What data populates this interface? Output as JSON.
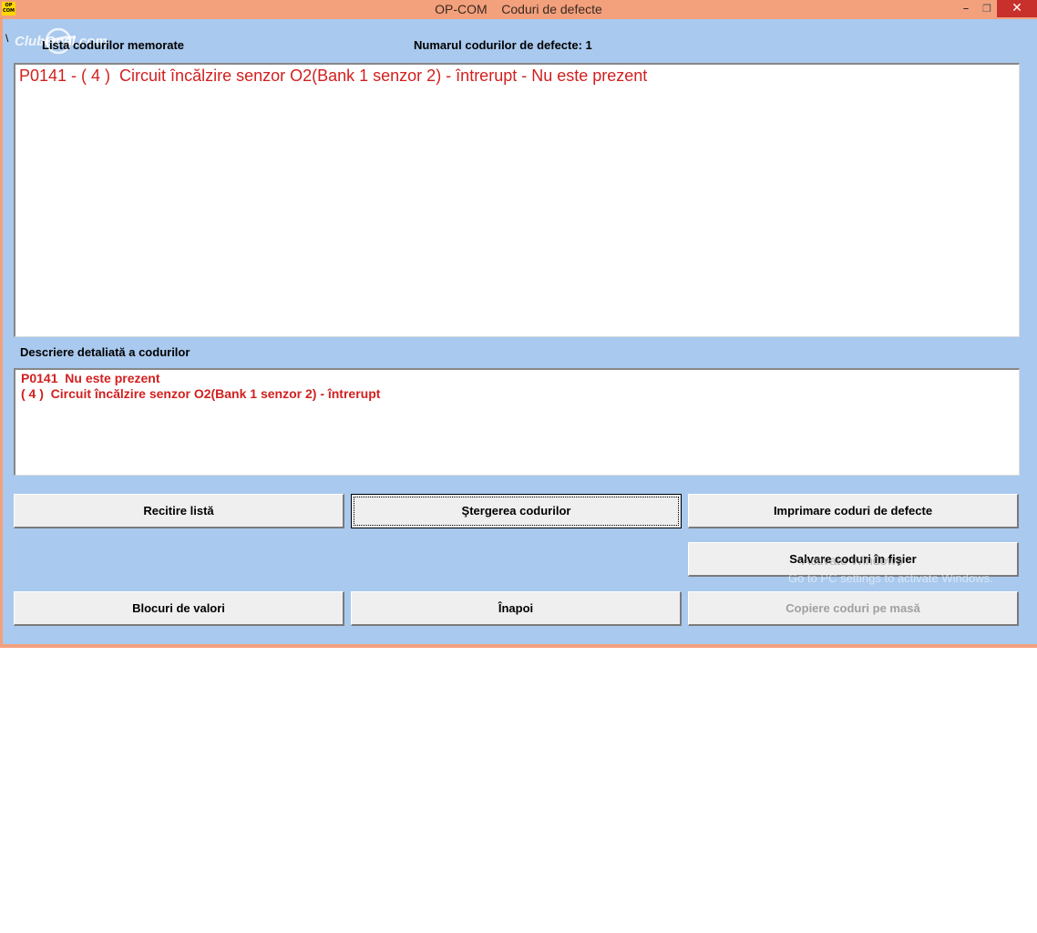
{
  "window": {
    "icon_text": "OP COM",
    "title": "OP-COM    Coduri de defecte",
    "controls": {
      "minimize": "–",
      "maximize": "❐",
      "close": "✕"
    }
  },
  "watermark": {
    "text": "ClubOpel.com"
  },
  "artifact_char": "\\",
  "labels": {
    "list_title": "Lista codurilor memorate",
    "count": "Numarul codurilor de defecte: 1",
    "description_title": "Descriere detaliată a codurilor"
  },
  "codes_list": [
    "P0141 - ( 4 )  Circuit încălzire senzor O2(Bank 1 senzor 2) - întrerupt - Nu este prezent"
  ],
  "description": {
    "line1": "P0141  Nu este prezent",
    "line2": "( 4 )  Circuit încălzire senzor O2(Bank 1 senzor 2) - întrerupt"
  },
  "buttons": {
    "recitire": "Recitire listă",
    "stergere": "Ştergerea codurilor",
    "imprimare": "Imprimare coduri de defecte",
    "salvare": "Salvare coduri în fişier",
    "blocuri": "Blocuri de valori",
    "inapoi": "Înapoi",
    "copiere": "Copiere coduri pe masă"
  },
  "os_overlay": {
    "line1": "Activate Windows",
    "line2": "Go to PC settings to activate Windows."
  },
  "colors": {
    "titlebar": "#f3a07d",
    "client_bg": "#a9c9ee",
    "error_text": "#d21f1f",
    "close_button": "#c7302b"
  }
}
